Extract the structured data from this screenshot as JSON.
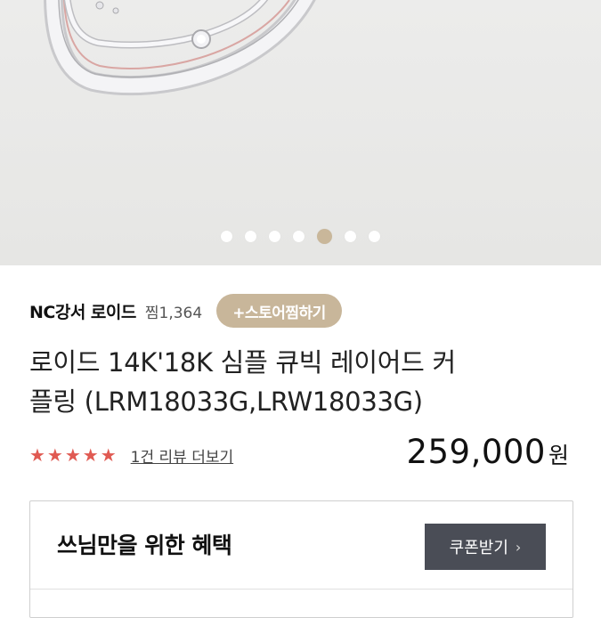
{
  "hero": {
    "image_name": "silver-cubic-ring-photo",
    "slide_count": 7,
    "active_slide": 5
  },
  "store": {
    "name": "NC강서 로이드",
    "likes": "찜1,364",
    "like_button": "+스토어찜하기"
  },
  "product": {
    "title_line1": "로이드 14K'18K 심플 큐빅 레이어드 커",
    "title_line2": "플링 (LRM18033G,LRW18033G)",
    "stars": "★★★★★",
    "rating": 5,
    "review_link": "1건 리뷰 더보기",
    "price": "259,000",
    "price_unit": "원"
  },
  "benefit": {
    "title": "쓰님만을 위한 혜택",
    "coupon_button": "쿠폰받기",
    "chevron": "›"
  },
  "colors": {
    "accent": "#c8b69a",
    "star": "#e05a52",
    "coupon_bg": "#4a4d56"
  }
}
